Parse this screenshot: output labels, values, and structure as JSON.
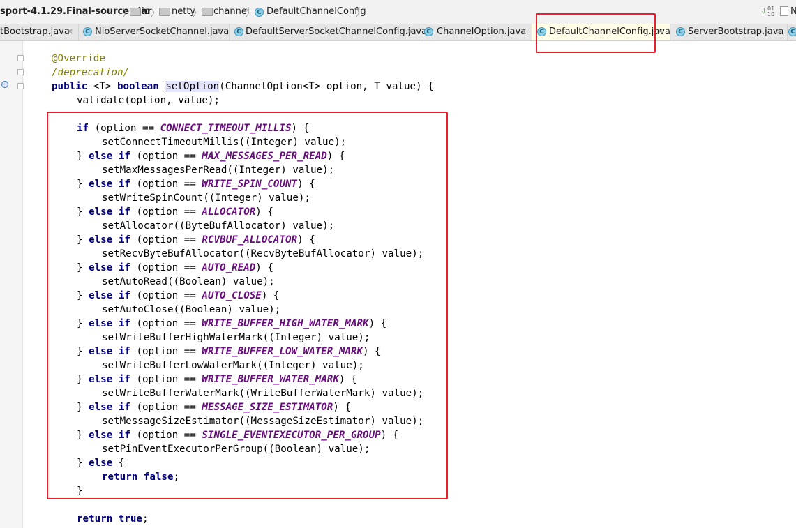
{
  "breadcrumb": {
    "jar": "sport-4.1.29.Final-sources.jar",
    "io": "io",
    "netty": "netty",
    "channel": "channel",
    "class": "DefaultChannelConfig",
    "right_label": "N"
  },
  "tabs": [
    {
      "label": "tBootstrap.java",
      "close": "×"
    },
    {
      "label": "NioServerSocketChannel.java",
      "close": "×"
    },
    {
      "label": "DefaultServerSocketChannelConfig.java",
      "close": "×"
    },
    {
      "label": "ChannelOption.java",
      "close": "×"
    },
    {
      "label": "DefaultChannelConfig.java",
      "close": "×"
    },
    {
      "label": "ServerBootstrap.java",
      "close": "×"
    }
  ],
  "code": {
    "l1": "@Override",
    "l2": "/deprecation/",
    "l3_public": "public",
    "l3_generic": "<T>",
    "l3_boolean": "boolean",
    "l3_method": "setOption",
    "l3_rest": "(ChannelOption<T> option, T value) {",
    "l4": "validate(option, value);",
    "if": "if",
    "else": "else",
    "return": "return",
    "false": "false",
    "true": "true",
    "branches": [
      {
        "const": "CONNECT_TIMEOUT_MILLIS",
        "call": "setConnectTimeoutMillis((Integer) value);"
      },
      {
        "const": "MAX_MESSAGES_PER_READ",
        "call": "setMaxMessagesPerRead((Integer) value);"
      },
      {
        "const": "WRITE_SPIN_COUNT",
        "call": "setWriteSpinCount((Integer) value);"
      },
      {
        "const": "ALLOCATOR",
        "call": "setAllocator((ByteBufAllocator) value);"
      },
      {
        "const": "RCVBUF_ALLOCATOR",
        "call": "setRecvByteBufAllocator((RecvByteBufAllocator) value);"
      },
      {
        "const": "AUTO_READ",
        "call": "setAutoRead((Boolean) value);"
      },
      {
        "const": "AUTO_CLOSE",
        "call": "setAutoClose((Boolean) value);"
      },
      {
        "const": "WRITE_BUFFER_HIGH_WATER_MARK",
        "call": "setWriteBufferHighWaterMark((Integer) value);"
      },
      {
        "const": "WRITE_BUFFER_LOW_WATER_MARK",
        "call": "setWriteBufferLowWaterMark((Integer) value);"
      },
      {
        "const": "WRITE_BUFFER_WATER_MARK",
        "call": "setWriteBufferWaterMark((WriteBufferWaterMark) value);"
      },
      {
        "const": "MESSAGE_SIZE_ESTIMATOR",
        "call": "setMessageSizeEstimator((MessageSizeEstimator) value);"
      },
      {
        "const": "SINGLE_EVENTEXECUTOR_PER_GROUP",
        "call": "setPinEventExecutorPerGroup((Boolean) value);"
      }
    ]
  },
  "colors": {
    "keyword": "#000080",
    "annotation": "#808000",
    "constant": "#660e7a",
    "highlight_box": "#e8212c"
  }
}
